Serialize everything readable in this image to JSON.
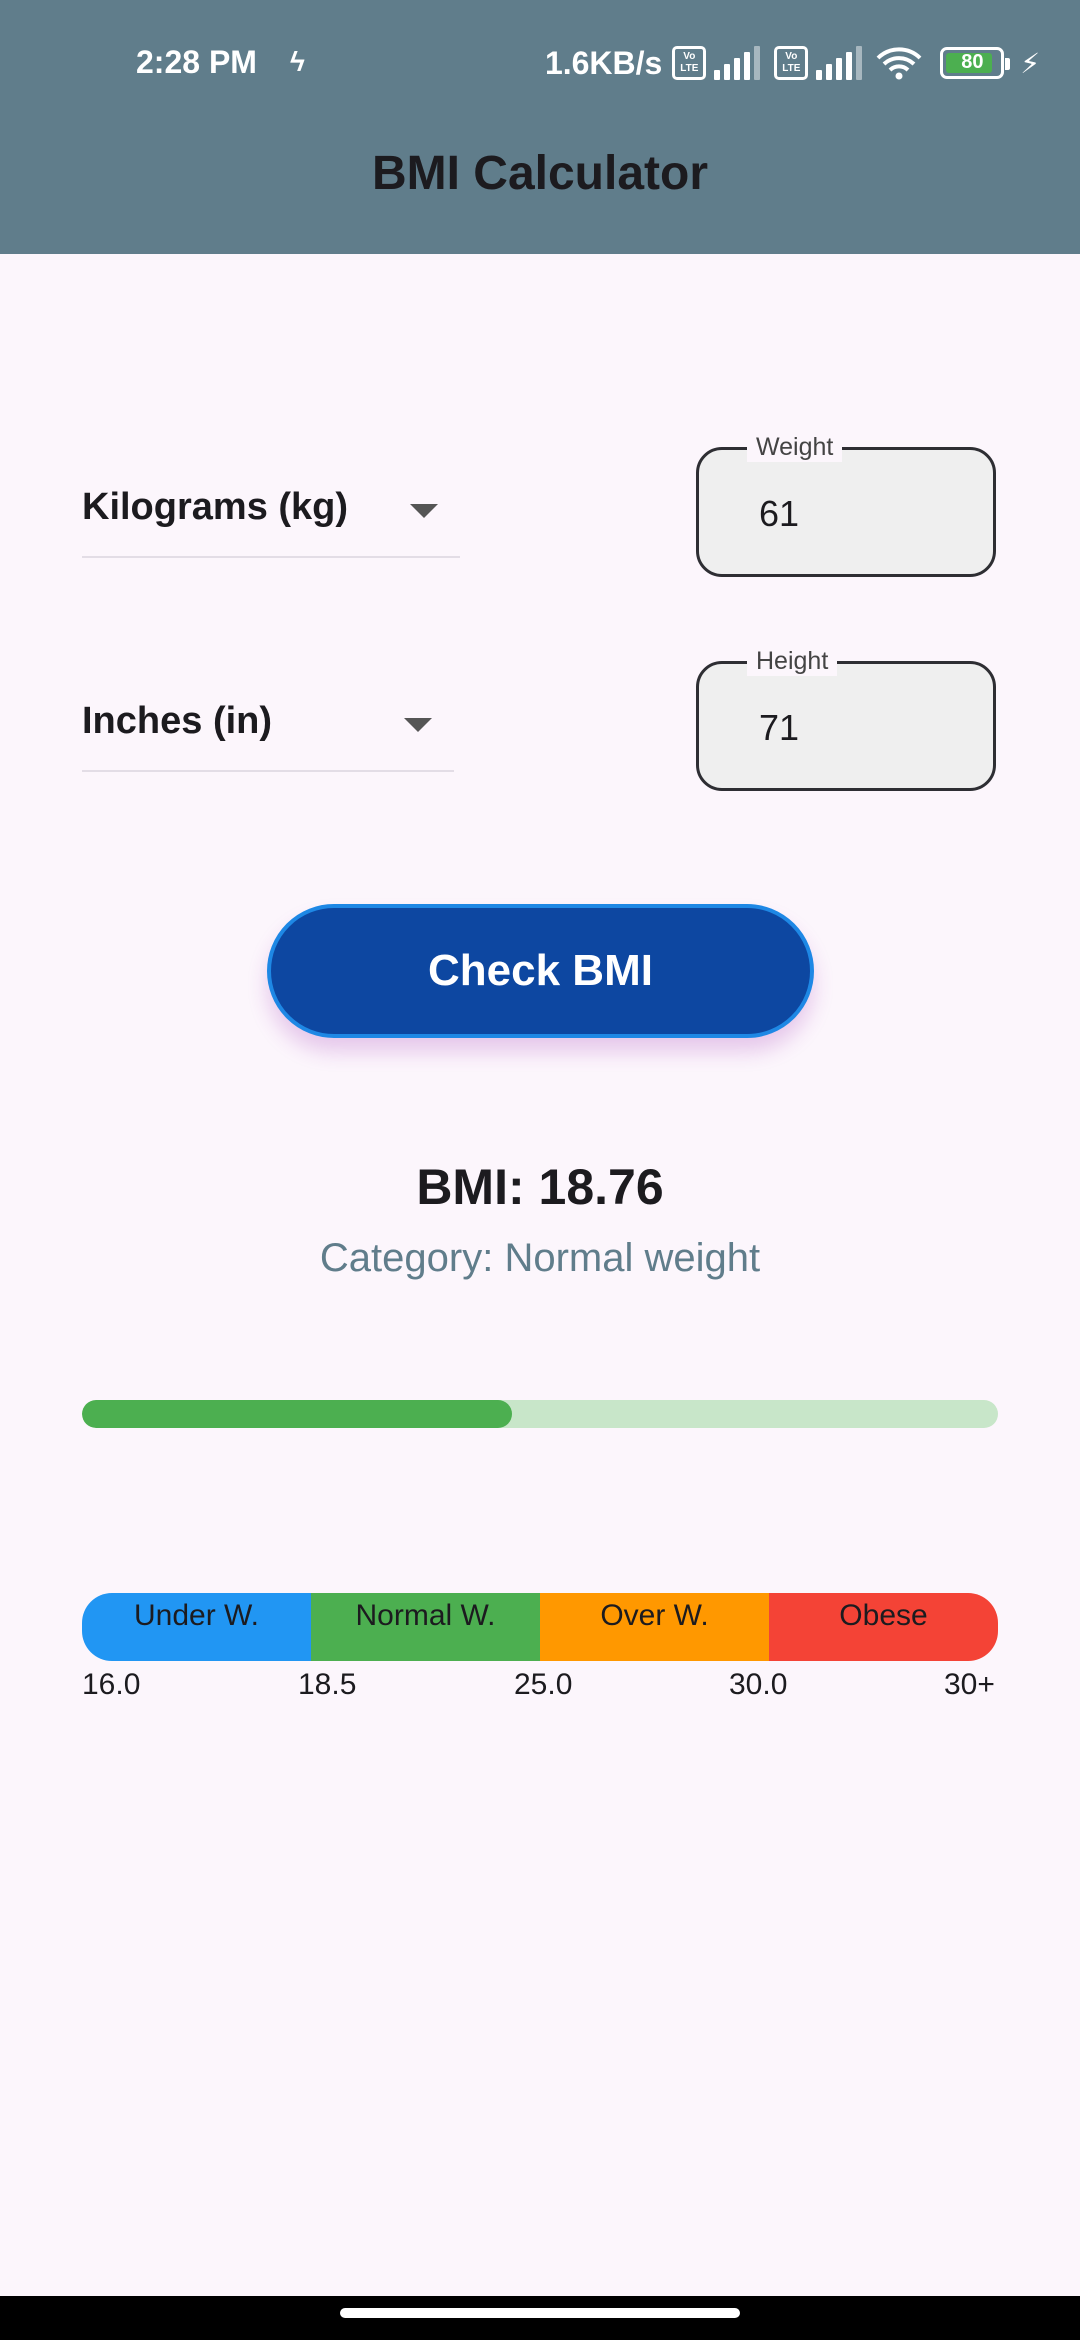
{
  "status_bar": {
    "time": "2:28 PM",
    "speed": "1.6KB/s",
    "volte_1": "Vo LTE",
    "volte_2": "Vo LTE",
    "battery": "80"
  },
  "app_bar": {
    "title": "BMI Calculator"
  },
  "form": {
    "weight_unit": "Kilograms (kg)",
    "height_unit": "Inches (in)",
    "weight_label": "Weight",
    "weight_value": "61",
    "height_label": "Height",
    "height_value": "71",
    "check_label": "Check BMI"
  },
  "result": {
    "bmi_text": "BMI: 18.76",
    "category_text": "Category: Normal weight",
    "progress_fraction": 0.469
  },
  "scale": {
    "segments": [
      "Under W.",
      "Normal W.",
      "Over W.",
      "Obese"
    ],
    "ticks": [
      "16.0",
      "18.5",
      "25.0",
      "30.0",
      "30+"
    ]
  },
  "colors": {
    "app_bar": "#607d8b",
    "button": "#0d47a1",
    "progress": "#4caf50",
    "underweight": "#2196f3",
    "normal": "#4caf50",
    "overweight": "#ff9800",
    "obese": "#f44336"
  }
}
